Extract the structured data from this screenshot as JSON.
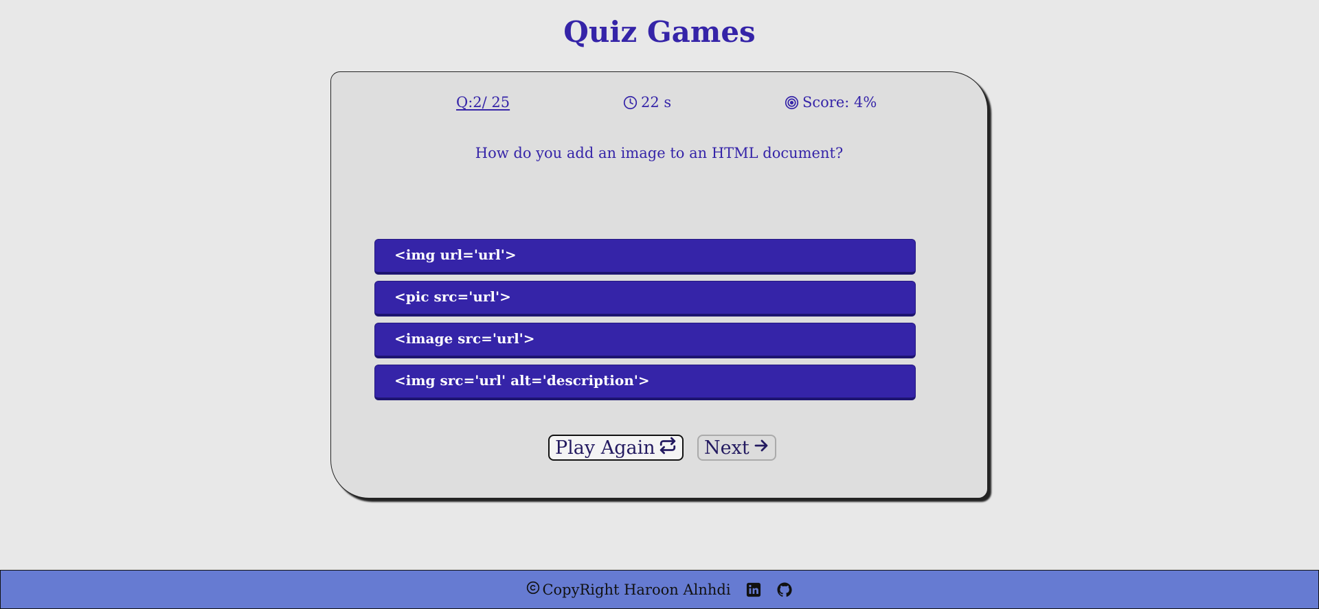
{
  "header": {
    "title": "Quiz Games"
  },
  "stats": {
    "question_counter": "Q:2/ 25",
    "time_remaining": "22 s",
    "score": "Score: 4%"
  },
  "question": {
    "text": "How do you add an image to an HTML document?",
    "answers": [
      "<img url='url'>",
      "<pic src='url'>",
      "<image src='url'>",
      "<img src='url' alt='description'>"
    ]
  },
  "controls": {
    "play_again_label": "Play Again",
    "next_label": "Next"
  },
  "footer": {
    "copyright": "CopyRight Haroon Alnhdi",
    "icons": [
      "copyright-icon",
      "linkedin-icon",
      "github-icon"
    ]
  },
  "colors": {
    "accent": "#3524a8",
    "background": "#e8e8e8",
    "card": "#dedede",
    "footer": "#667bd2"
  }
}
